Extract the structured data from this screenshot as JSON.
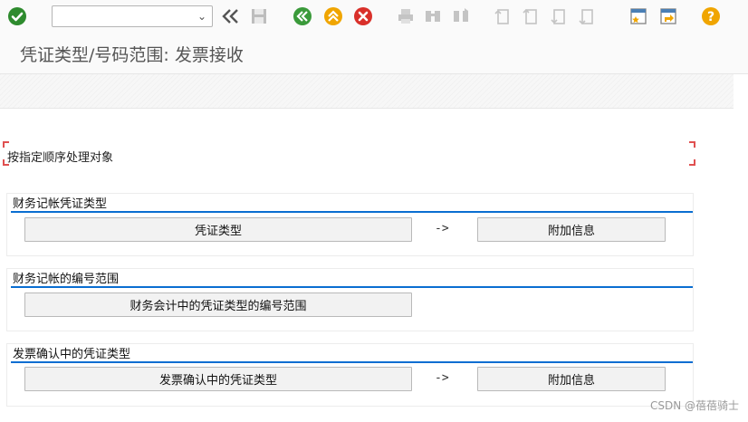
{
  "toolbar": {
    "command_field_value": "",
    "icons": [
      "enter-icon",
      "back-double-icon",
      "save-icon",
      "back-icon",
      "exit-icon",
      "cancel-icon",
      "print-icon",
      "find-icon",
      "find-next-icon",
      "first-page-icon",
      "prev-page-icon",
      "next-page-icon",
      "last-page-icon",
      "create-session-icon",
      "shortcut-icon",
      "help-icon"
    ]
  },
  "title": "凭证类型/号码范围: 发票接收",
  "instruction": "按指定顺序处理对象",
  "groups": [
    {
      "title": "财务记帐凭证类型",
      "button1": "凭证类型",
      "arrow": "->",
      "button2": "附加信息"
    },
    {
      "title": "财务记帐的编号范围",
      "button1": "财务会计中的凭证类型的编号范围"
    },
    {
      "title": "发票确认中的凭证类型",
      "button1": "发票确认中的凭证类型",
      "arrow": "->",
      "button2": "附加信息"
    }
  ],
  "watermark": "CSDN @蓓蓓骑士",
  "colors": {
    "accent_line": "#0a6ed1",
    "enter_green": "#2e8b2e",
    "nav_green": "#3a9a3a",
    "exit_orange": "#f0a500",
    "cancel_red": "#d9302a",
    "help_orange": "#f0a500",
    "frame_red": "#e05050"
  }
}
